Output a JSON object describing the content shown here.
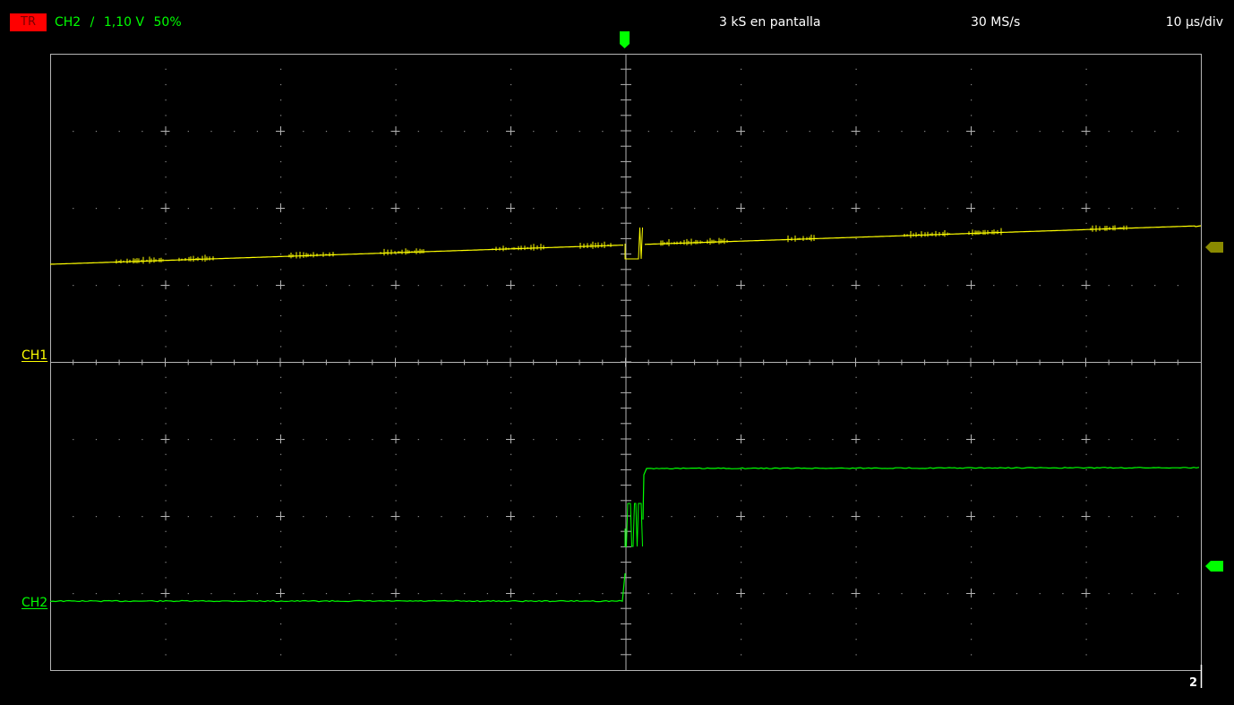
{
  "header": {
    "trigger_badge": "TR",
    "trigger_channel": "CH2",
    "trigger_slope": "/",
    "trigger_level": "1,10 V",
    "trigger_position": "50%",
    "samples_on_screen": "3 kS en pantalla",
    "sample_rate": "30 MS/s",
    "timebase": "10 µs/div"
  },
  "channels": {
    "ch1": {
      "label": "CH1",
      "color": "#ffff00"
    },
    "ch2": {
      "label": "CH2",
      "color": "#00ff00"
    }
  },
  "footer": {
    "corner_number": "2"
  },
  "colors": {
    "background": "#000000",
    "grid": "#b4b4b4",
    "trigger_badge": "#ff0000",
    "ch1_marker": "#8a8a00",
    "ch2_marker": "#00ff00"
  }
}
